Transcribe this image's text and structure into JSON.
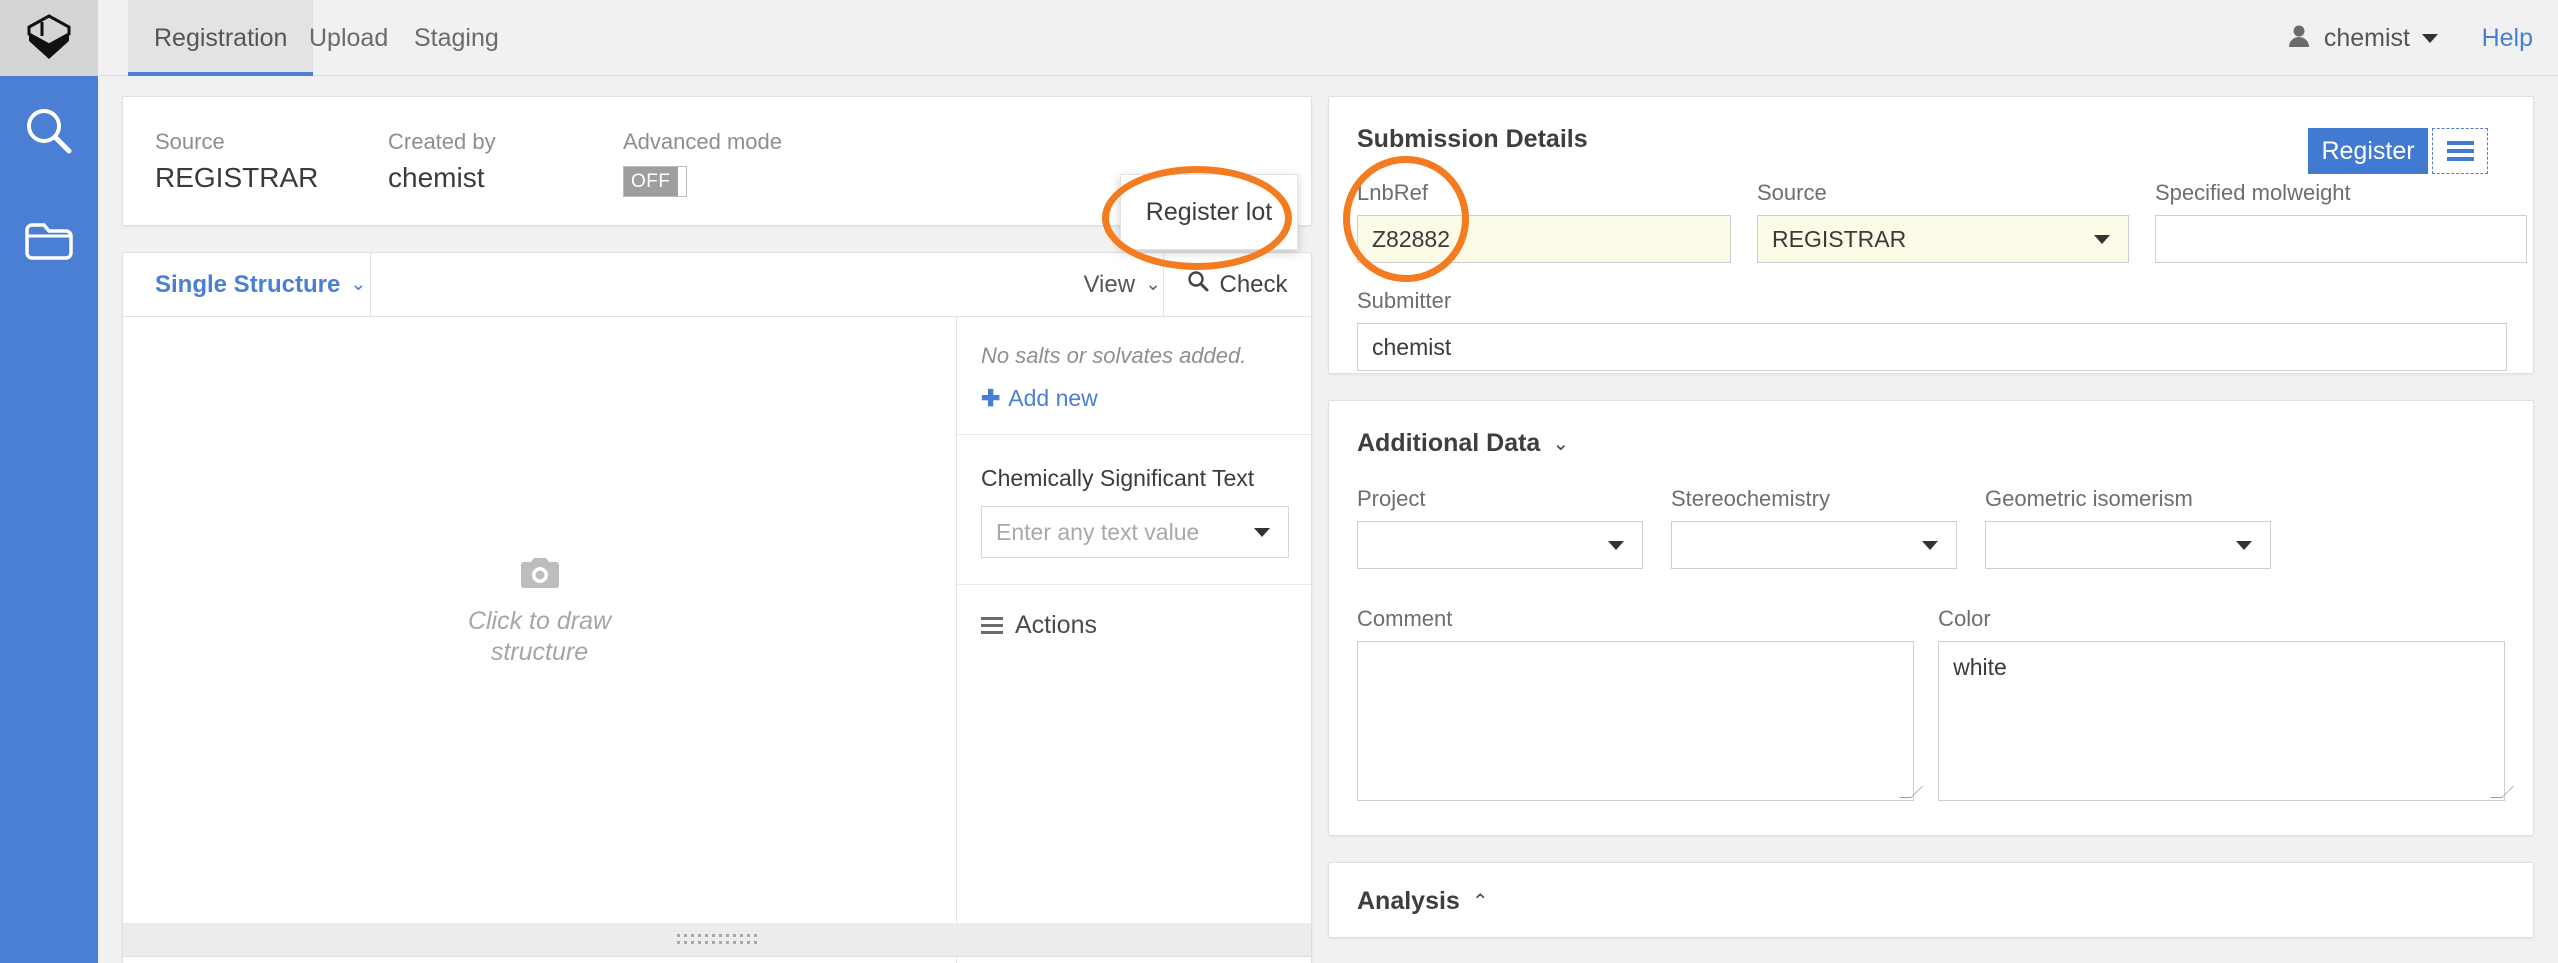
{
  "app": {
    "logo_icon": "hexagon-logo-icon",
    "rail_icons": [
      {
        "name": "search-icon",
        "label": "Search"
      },
      {
        "name": "folder-icon",
        "label": "Browse"
      }
    ]
  },
  "topbar": {
    "tabs": [
      {
        "id": "registration",
        "label": "Registration",
        "active": true
      },
      {
        "id": "upload",
        "label": "Upload",
        "active": false
      },
      {
        "id": "staging",
        "label": "Staging",
        "active": false
      }
    ],
    "user": {
      "name": "chemist",
      "icon": "user-avatar-icon",
      "caret": "chevron-down-icon"
    },
    "help_label": "Help"
  },
  "meta": {
    "source_label": "Source",
    "source_value": "REGISTRAR",
    "created_by_label": "Created by",
    "created_by_value": "chemist",
    "advanced_mode_label": "Advanced mode",
    "advanced_mode_state": "OFF"
  },
  "actions_bar": {
    "register_label": "Register",
    "menu_icon": "hamburger-menu-icon",
    "dropdown": {
      "items": [
        {
          "label": "Register lot"
        }
      ]
    }
  },
  "structure": {
    "mode_label": "Single Structure",
    "mode_caret": "chevron-down-icon",
    "view_label": "View",
    "view_caret": "chevron-down-icon",
    "check_label": "Check",
    "check_icon": "magnifier-icon",
    "draw_icon": "camera-icon",
    "draw_placeholder": "Click to draw structure",
    "salts_empty": "No salts or solvates added.",
    "add_new_label": "Add new",
    "add_new_icon": "plus-icon",
    "cst_label": "Chemically Significant Text",
    "cst_placeholder": "Enter any text value",
    "cst_caret": "chevron-down-icon",
    "actions_label": "Actions",
    "actions_icon": "hamburger-menu-icon",
    "drag_handle_icon": "drag-handle-dots-icon"
  },
  "submission": {
    "title": "Submission Details",
    "lnbref_label": "LnbRef",
    "lnbref_value": "Z82882",
    "source_label": "Source",
    "source_value": "REGISTRAR",
    "source_caret": "chevron-down-icon",
    "molweight_label": "Specified molweight",
    "molweight_value": "",
    "submitter_label": "Submitter",
    "submitter_value": "chemist"
  },
  "additional": {
    "title": "Additional Data",
    "caret": "chevron-down-icon",
    "project_label": "Project",
    "project_value": "",
    "stereo_label": "Stereochemistry",
    "stereo_value": "",
    "geoiso_label": "Geometric isomerism",
    "geoiso_value": "",
    "comment_label": "Comment",
    "comment_value": "",
    "color_label": "Color",
    "color_value": "white"
  },
  "analysis": {
    "title": "Analysis",
    "caret": "chevron-up-icon"
  },
  "annotations": [
    {
      "name": "annot-register-lot",
      "target": "Register lot",
      "color": "#f47b20",
      "shape": "ellipse"
    },
    {
      "name": "annot-lnbref",
      "target": "LnbRef",
      "color": "#f47b20",
      "shape": "ellipse"
    }
  ],
  "colors": {
    "brand_blue": "#4a7fd4",
    "primary_button": "#4279d1",
    "annotation_orange": "#f47b20",
    "highlight_field": "#fbfbe8"
  }
}
